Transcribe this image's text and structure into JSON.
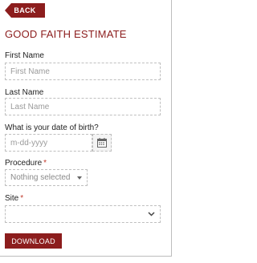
{
  "header": {
    "back_label": "BACK"
  },
  "form": {
    "title": "GOOD FAITH ESTIMATE",
    "first_name": {
      "label": "First Name",
      "placeholder": "First Name"
    },
    "last_name": {
      "label": "Last Name",
      "placeholder": "Last Name"
    },
    "dob": {
      "label": "What is your date of birth?",
      "placeholder": "m-dd-yyyy"
    },
    "procedure": {
      "label": "Procedure",
      "required_mark": "*",
      "value": "Nothing selected"
    },
    "site": {
      "label": "Site",
      "required_mark": "*",
      "value": ""
    },
    "download_label": "DOWNLOAD"
  },
  "colors": {
    "accent": "#8c1d1d",
    "required": "#c0392b"
  },
  "icons": {
    "dob_button": "calendar-icon",
    "procedure_caret": "caret-down-icon",
    "site_caret": "chevron-down-icon"
  }
}
